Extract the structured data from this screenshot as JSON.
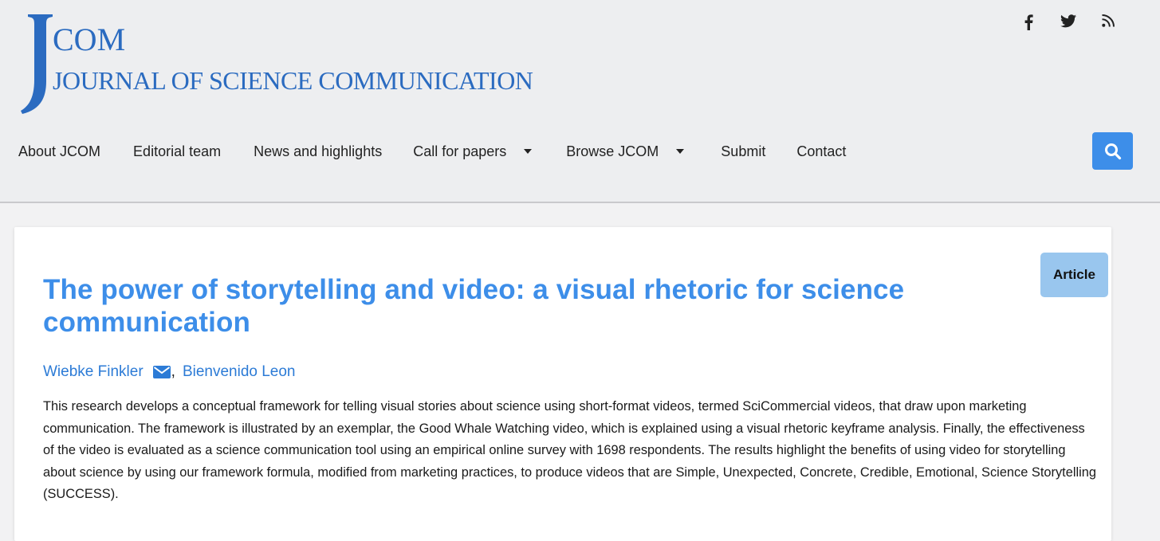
{
  "header": {
    "logo": {
      "letter": "J",
      "com": "COM",
      "full_name": "JOURNAL OF SCIENCE COMMUNICATION"
    },
    "social_icons": [
      "facebook-icon",
      "twitter-icon",
      "rss-icon"
    ],
    "nav": [
      {
        "label": "About JCOM",
        "dropdown": false
      },
      {
        "label": "Editorial team",
        "dropdown": false
      },
      {
        "label": "News and highlights",
        "dropdown": false
      },
      {
        "label": "Call for papers",
        "dropdown": true
      },
      {
        "label": "Browse JCOM",
        "dropdown": true
      },
      {
        "label": "Submit",
        "dropdown": false
      },
      {
        "label": "Contact",
        "dropdown": false
      }
    ],
    "search_icon": "search-icon"
  },
  "article": {
    "type_badge": "Article",
    "title": "The power of storytelling and video: a visual rhetoric for science communication",
    "authors": [
      {
        "name": "Wiebke Finkler",
        "has_email": true
      },
      {
        "name": "Bienvenido Leon",
        "has_email": false
      }
    ],
    "author_separator": ",",
    "abstract": "This research develops a conceptual framework for telling visual stories about science using short-format videos, termed SciCommercial videos, that draw upon marketing communication. The framework is illustrated by an exemplar, the Good Whale Watching video, which is explained using a visual rhetoric keyframe analysis. Finally, the effectiveness of the video is evaluated as a science communication tool using an empirical online survey with 1698 respondents. The results highlight the benefits of using video for storytelling about science by using our framework formula, modified from marketing practices, to produce videos that are Simple, Unexpected, Concrete, Credible, Emotional, Science Storytelling (SUCCESS)."
  },
  "colors": {
    "brand_blue": "#2b6bc0",
    "title_blue": "#3d8ee9",
    "link_blue": "#2c7bd6",
    "badge_bg": "#99c6ee",
    "header_bg": "#edeef0",
    "page_bg": "#f2f2f3"
  }
}
